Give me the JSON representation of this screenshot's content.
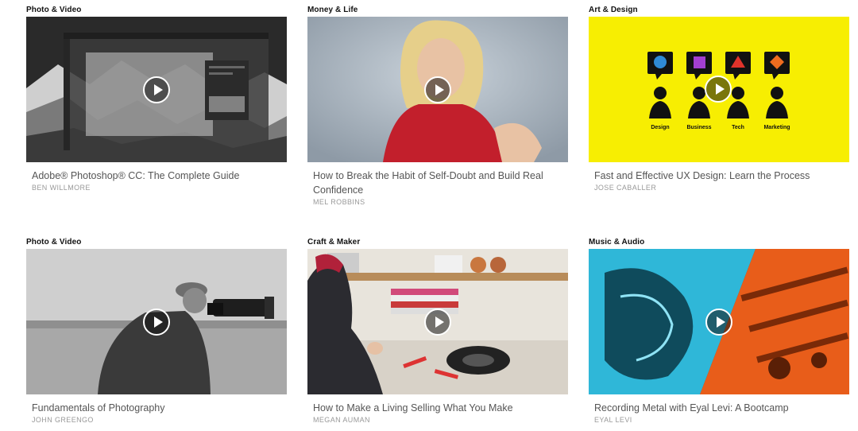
{
  "courses": [
    {
      "category": "Photo & Video",
      "title": "Adobe® Photoshop® CC: The Complete Guide",
      "author": "BEN WILLMORE"
    },
    {
      "category": "Money & Life",
      "title": "How to Break the Habit of Self-Doubt and Build Real Confidence",
      "author": "MEL ROBBINS"
    },
    {
      "category": "Art & Design",
      "title": "Fast and Effective UX Design: Learn the Process",
      "author": "JOSE CABALLER",
      "thumb_labels": [
        "Design",
        "Business",
        "Tech",
        "Marketing"
      ]
    },
    {
      "category": "Photo & Video",
      "title": "Fundamentals of Photography",
      "author": "JOHN GREENGO"
    },
    {
      "category": "Craft & Maker",
      "title": "How to Make a Living Selling What You Make",
      "author": "MEGAN AUMAN"
    },
    {
      "category": "Music & Audio",
      "title": "Recording Metal with Eyal Levi: A Bootcamp",
      "author": "EYAL LEVI"
    }
  ],
  "colors": {
    "yellow": "#f7ee02",
    "cyan": "#2fb7d8",
    "orange": "#e85d1a"
  },
  "icons": {
    "play": "play-icon"
  }
}
